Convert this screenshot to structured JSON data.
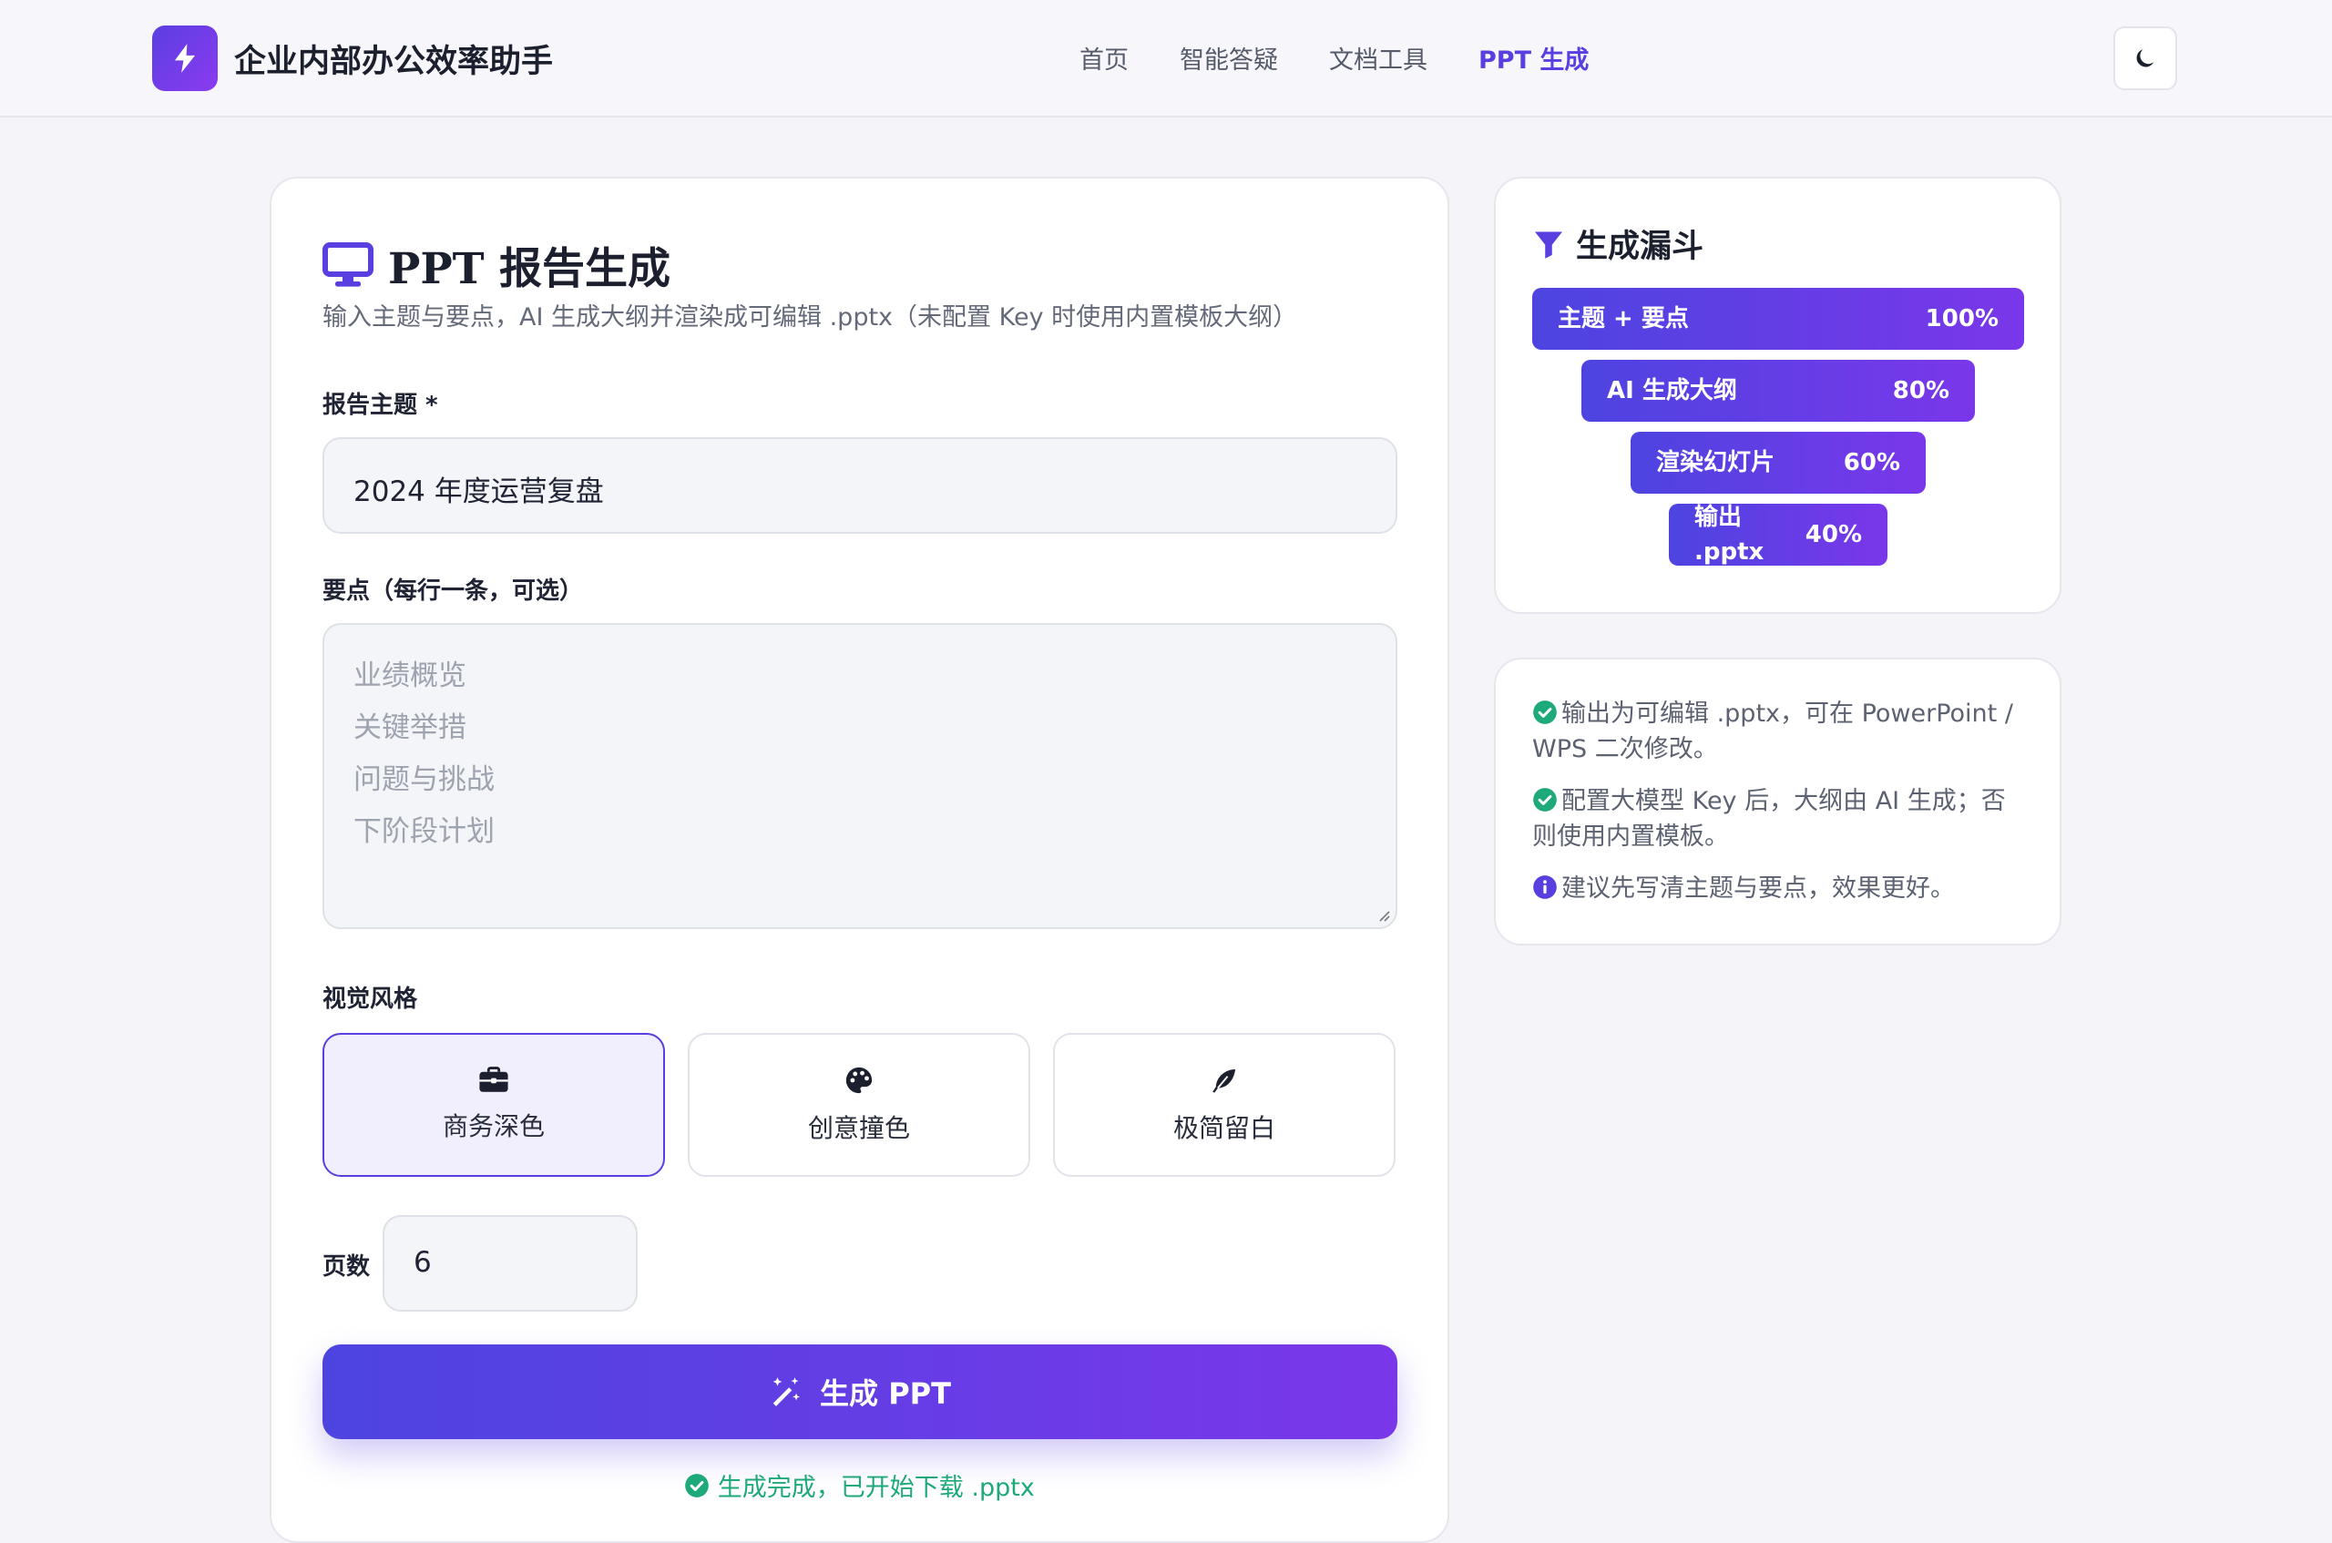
{
  "header": {
    "app_title": "企业内部办公效率助手",
    "logo_icon": "lightning-bolt-icon",
    "nav": [
      "首页",
      "智能答疑",
      "文档工具",
      "PPT 生成"
    ],
    "active_nav": "PPT 生成",
    "theme_toggle_icon": "moon-icon"
  },
  "form": {
    "title": "PPT 报告生成",
    "title_icon": "monitor-icon",
    "subtitle": "输入主题与要点，AI 生成大纲并渲染成可编辑 .pptx（未配置 Key 时使用内置模板大纲）",
    "topic_label": "报告主题 *",
    "topic_value": "2024 年度运营复盘",
    "points_label": "要点（每行一条，可选）",
    "points_placeholder_lines": [
      "业绩概览",
      "关键举措",
      "问题与挑战",
      "下阶段计划"
    ],
    "style_label": "视觉风格",
    "styles": [
      {
        "label": "商务深色",
        "icon": "briefcase-icon",
        "selected": true
      },
      {
        "label": "创意撞色",
        "icon": "palette-icon",
        "selected": false
      },
      {
        "label": "极简留白",
        "icon": "feather-icon",
        "selected": false
      }
    ],
    "pages_label": "页数",
    "pages_value": "6",
    "generate_button": "生成 PPT",
    "generate_icon": "magic-wand-icon",
    "status_text": "生成完成，已开始下载 .pptx",
    "status_icon": "check-circle-icon"
  },
  "funnel": {
    "title": "生成漏斗",
    "title_icon": "funnel-icon",
    "stages": [
      {
        "label": "主题 + 要点",
        "percent": "100%"
      },
      {
        "label": "AI 生成大纲",
        "percent": "80%"
      },
      {
        "label": "渲染幻灯片",
        "percent": "60%"
      },
      {
        "label": "输出 .pptx",
        "percent": "40%"
      }
    ]
  },
  "notes": [
    {
      "icon": "check-circle-icon",
      "text": "输出为可编辑 .pptx，可在 PowerPoint / WPS 二次修改。"
    },
    {
      "icon": "check-circle-icon",
      "text": "配置大模型 Key 后，大纲由 AI 生成；否则使用内置模板。"
    },
    {
      "icon": "info-circle-icon",
      "text": "建议先写清主题与要点，效果更好。"
    }
  ],
  "colors": {
    "accent": "#5a3fe0",
    "accent_end": "#7a37ea",
    "success": "#1ea97a",
    "page_bg": "#f5f5f9"
  }
}
